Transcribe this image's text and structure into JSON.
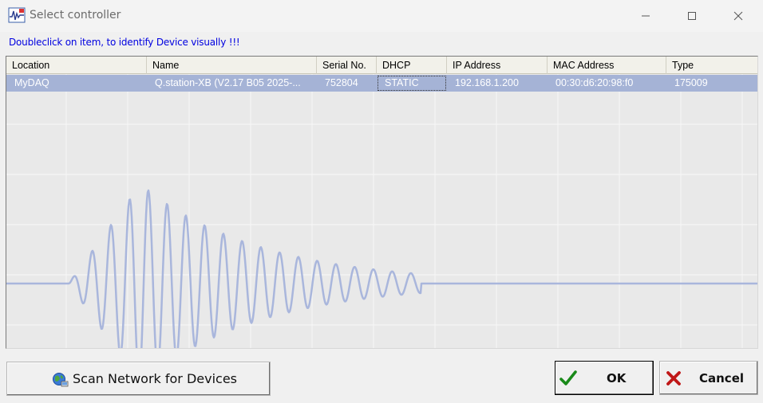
{
  "window": {
    "title": "Select controller",
    "icon": "app-waveform-icon",
    "controls": {
      "minimize_icon": "minimize-icon",
      "maximize_icon": "maximize-icon",
      "close_icon": "close-icon"
    }
  },
  "hint": "Doubleclick on item, to identify Device visually !!!",
  "table": {
    "columns": [
      "Location",
      "Name",
      "Serial No.",
      "DHCP",
      "IP Address",
      "MAC Address",
      "Type"
    ],
    "rows": [
      {
        "location": "MyDAQ",
        "name": "Q.station-XB (V2.17 B05 2025-...",
        "serial": "752804",
        "dhcp": "STATIC",
        "ip": "192.168.1.200",
        "mac": "00:30:d6:20:98:f0",
        "type": "175009",
        "selected": true
      }
    ]
  },
  "buttons": {
    "scan": "Scan Network for Devices",
    "ok": "OK",
    "cancel": "Cancel"
  },
  "colors": {
    "hint_text": "#0000e0",
    "selection": "#a5b3d6",
    "waveform": "#a9b6dc",
    "ok_check": "#1a8a1a",
    "cancel_x": "#c01818"
  }
}
